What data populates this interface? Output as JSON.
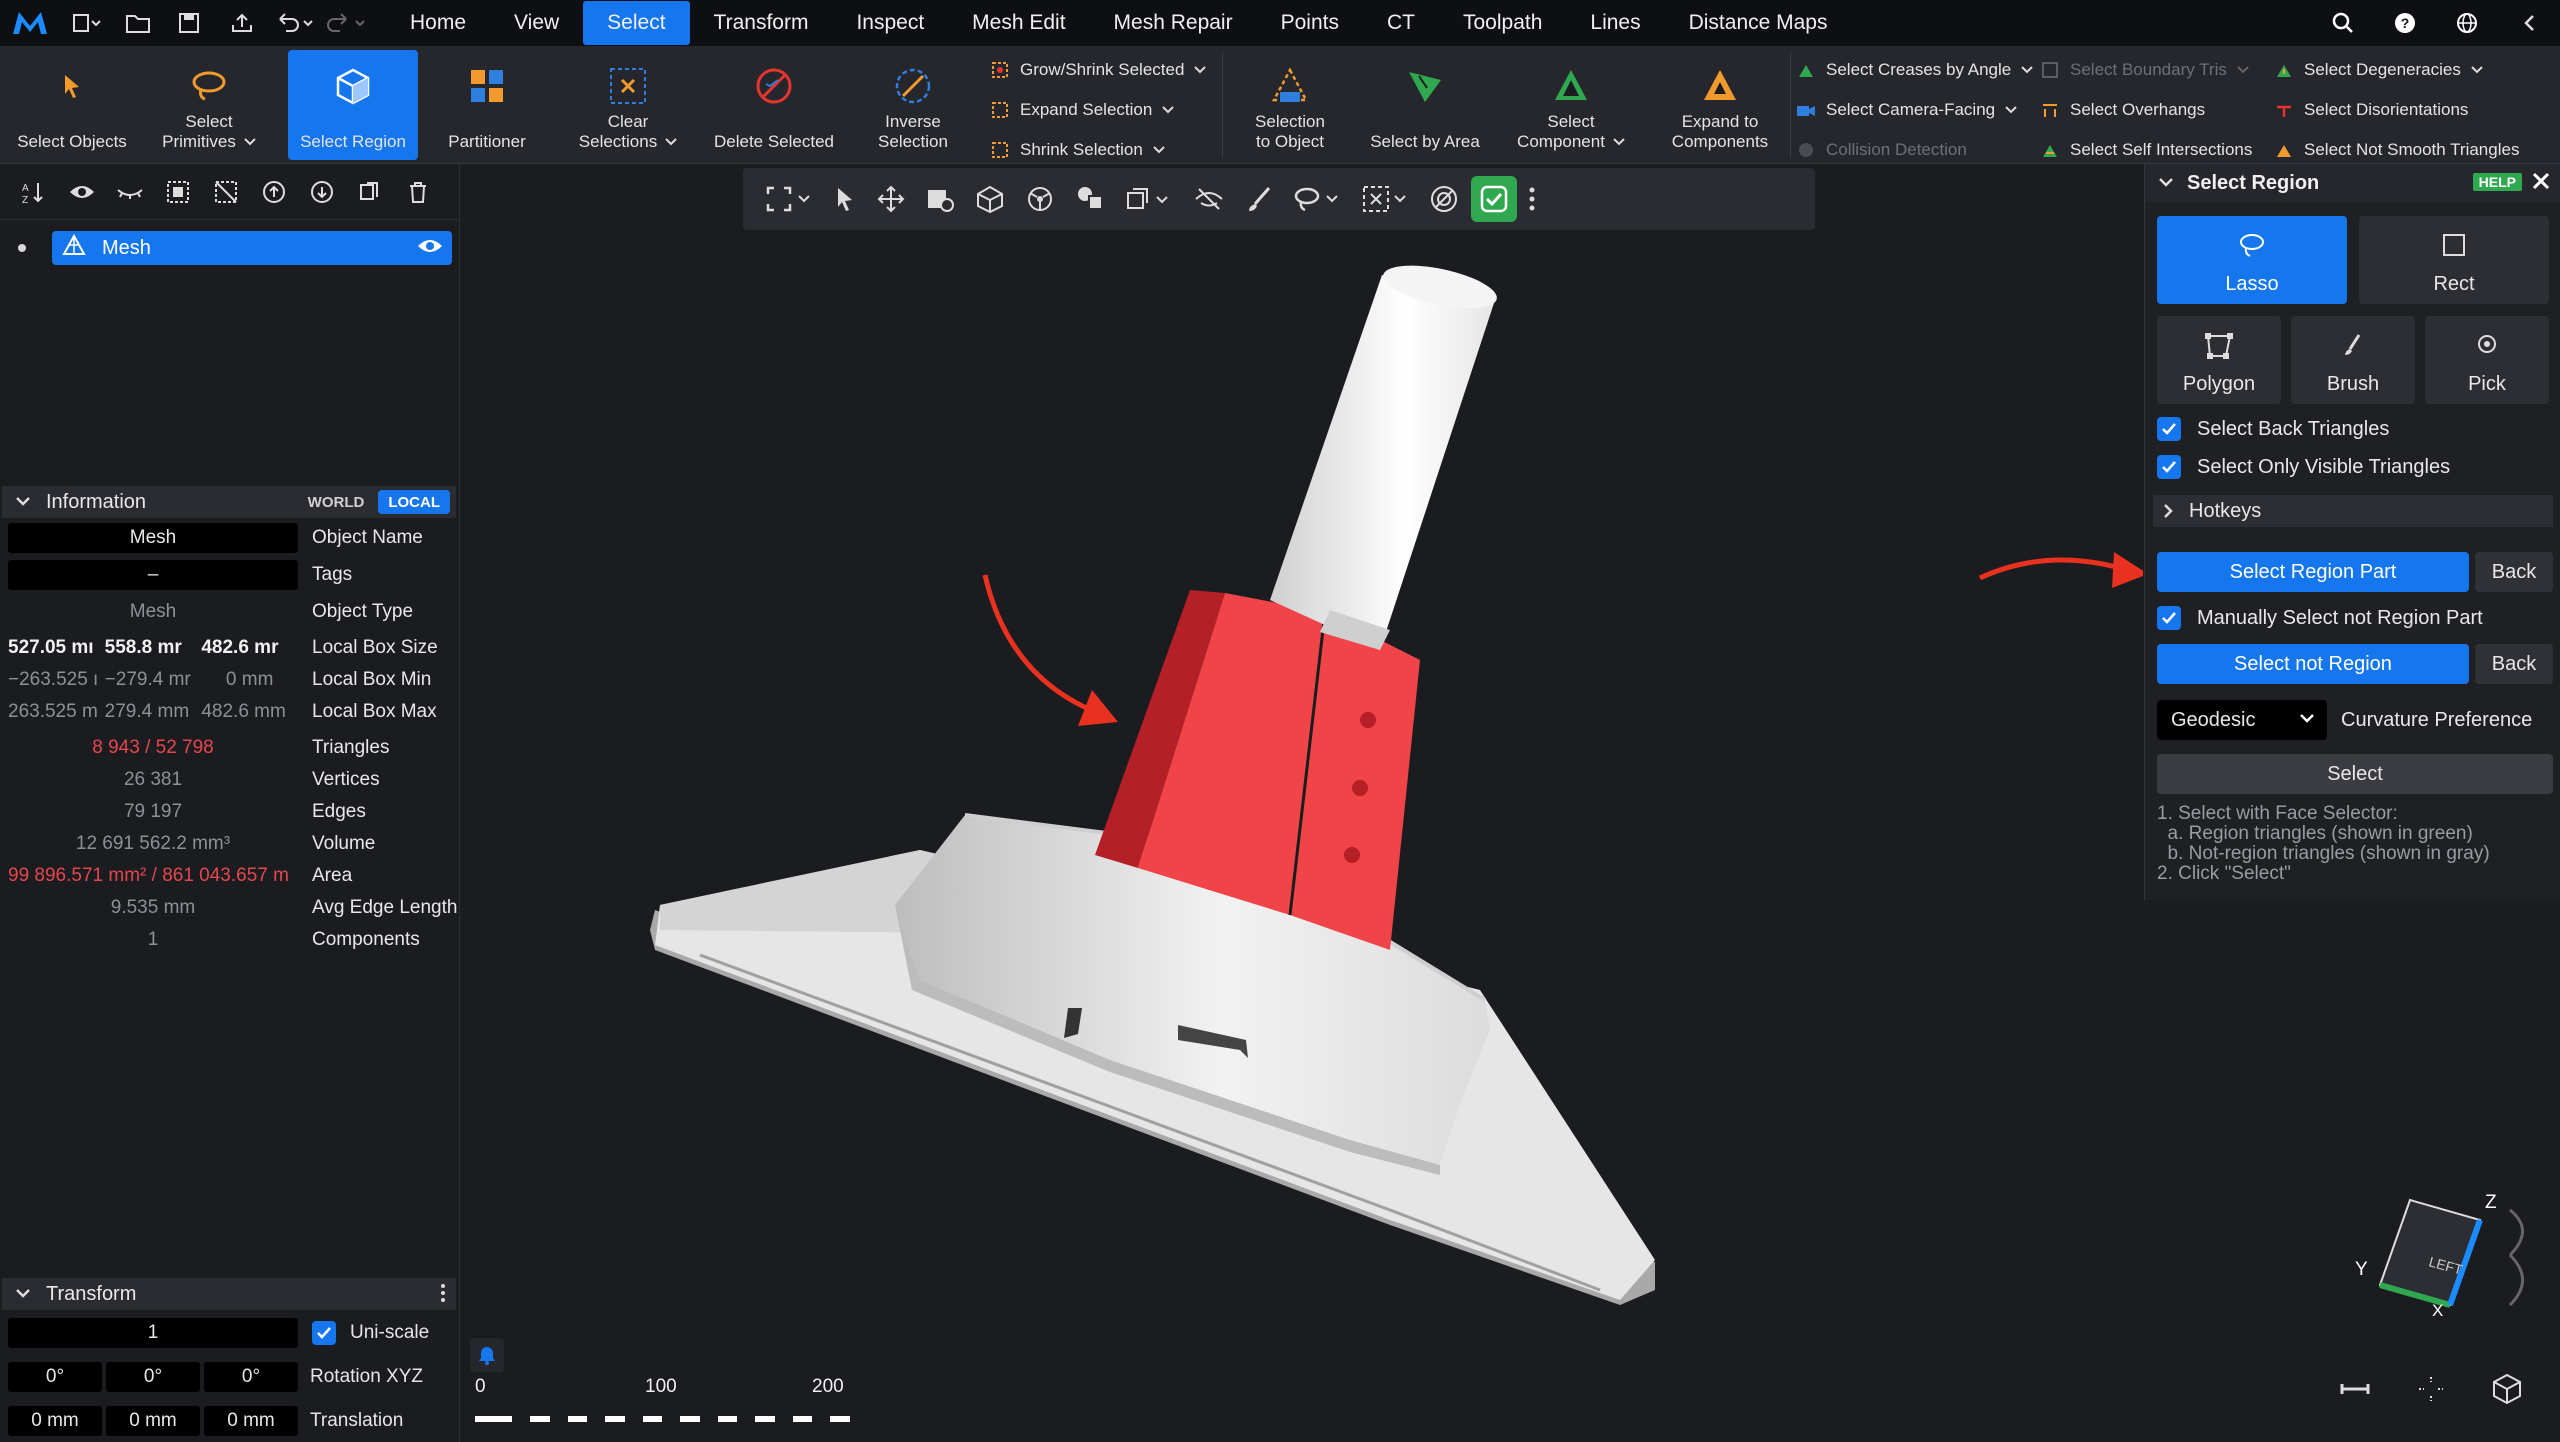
{
  "menu": {
    "items": [
      "Home",
      "View",
      "Select",
      "Transform",
      "Inspect",
      "Mesh Edit",
      "Mesh Repair",
      "Points",
      "CT",
      "Toolpath",
      "Lines",
      "Distance Maps"
    ],
    "active": "Select"
  },
  "ribbon": {
    "select_objects": "Select Objects",
    "select_primitives": [
      "Select",
      "Primitives"
    ],
    "select_region": "Select Region",
    "partitioner": "Partitioner",
    "clear_selections": [
      "Clear",
      "Selections"
    ],
    "delete_selected": "Delete Selected",
    "inverse_selection": [
      "Inverse",
      "Selection"
    ],
    "grow_shrink": "Grow/Shrink Selected",
    "expand_selection": "Expand Selection",
    "shrink_selection": "Shrink Selection",
    "selection_to_object": [
      "Selection",
      "to Object"
    ],
    "select_by_area": "Select by Area",
    "select_component": [
      "Select",
      "Component"
    ],
    "expand_to_components": [
      "Expand to",
      "Components"
    ],
    "creases": "Select Creases by Angle",
    "camera_facing": "Select Camera-Facing",
    "collision": "Collision Detection",
    "boundary_tris": "Select Boundary Tris",
    "overhangs": "Select Overhangs",
    "self_intersections": "Select Self Intersections",
    "degeneracies": "Select Degeneracies",
    "disorientations": "Select Disorientations",
    "not_smooth": "Select Not Smooth Triangles"
  },
  "tree": {
    "item": "Mesh"
  },
  "information": {
    "title": "Information",
    "world": "WORLD",
    "local": "LOCAL",
    "object_name": {
      "value": "Mesh",
      "label": "Object Name"
    },
    "tags": {
      "value": "–",
      "label": "Tags"
    },
    "object_type": {
      "value": "Mesh",
      "label": "Object Type"
    },
    "box_size": {
      "values": [
        "527.05 mı",
        "558.8 mr",
        "482.6 mr"
      ],
      "label": "Local Box Size"
    },
    "box_min": {
      "values": [
        "−263.525 ı",
        "−279.4 mr",
        "0 mm"
      ],
      "label": "Local Box Min"
    },
    "box_max": {
      "values": [
        "263.525 m",
        "279.4 mm",
        "482.6 mm"
      ],
      "label": "Local Box Max"
    },
    "triangles": {
      "value": "8 943 / 52 798",
      "label": "Triangles"
    },
    "vertices": {
      "value": "26 381",
      "label": "Vertices"
    },
    "edges": {
      "value": "79 197",
      "label": "Edges"
    },
    "volume": {
      "value": "12 691 562.2 mm³",
      "label": "Volume"
    },
    "area": {
      "value": "99 896.571 mm² / 861 043.657 m",
      "label": "Area"
    },
    "avg_edge": {
      "value": "9.535 mm",
      "label": "Avg Edge Length"
    },
    "components": {
      "value": "1",
      "label": "Components"
    }
  },
  "transform": {
    "title": "Transform",
    "scale_value": "1",
    "uniscale_label": "Uni-scale",
    "rotation": {
      "values": [
        "0°",
        "0°",
        "0°"
      ],
      "label": "Rotation XYZ"
    },
    "translation": {
      "values": [
        "0 mm",
        "0 mm",
        "0 mm"
      ],
      "label": "Translation"
    }
  },
  "panel": {
    "title": "Select Region",
    "help": "HELP",
    "modes": {
      "lasso": "Lasso",
      "rect": "Rect",
      "polygon": "Polygon",
      "brush": "Brush",
      "pick": "Pick"
    },
    "back_triangles": "Select Back Triangles",
    "visible_only": "Select Only Visible Triangles",
    "hotkeys": "Hotkeys",
    "select_region_part": "Select Region Part",
    "back1": "Back",
    "manual_not_region": "Manually Select not Region Part",
    "select_not_region": "Select not Region",
    "back2": "Back",
    "geodesic": "Geodesic",
    "curvature": "Curvature Preference",
    "select": "Select",
    "instructions": "1. Select with Face Selector:\n  a. Region triangles (shown in green)\n  b. Not-region triangles (shown in gray)\n2. Click \"Select\""
  },
  "scale": {
    "ticks": [
      "0",
      "100",
      "200"
    ]
  },
  "gizmo": {
    "z": "Z",
    "y": "Y",
    "x": "X",
    "face": "LEFT"
  },
  "colors": {
    "accent": "#1576ee",
    "selection": "#f04448",
    "arrow": "#e8311f",
    "confirm": "#2fa84f"
  }
}
